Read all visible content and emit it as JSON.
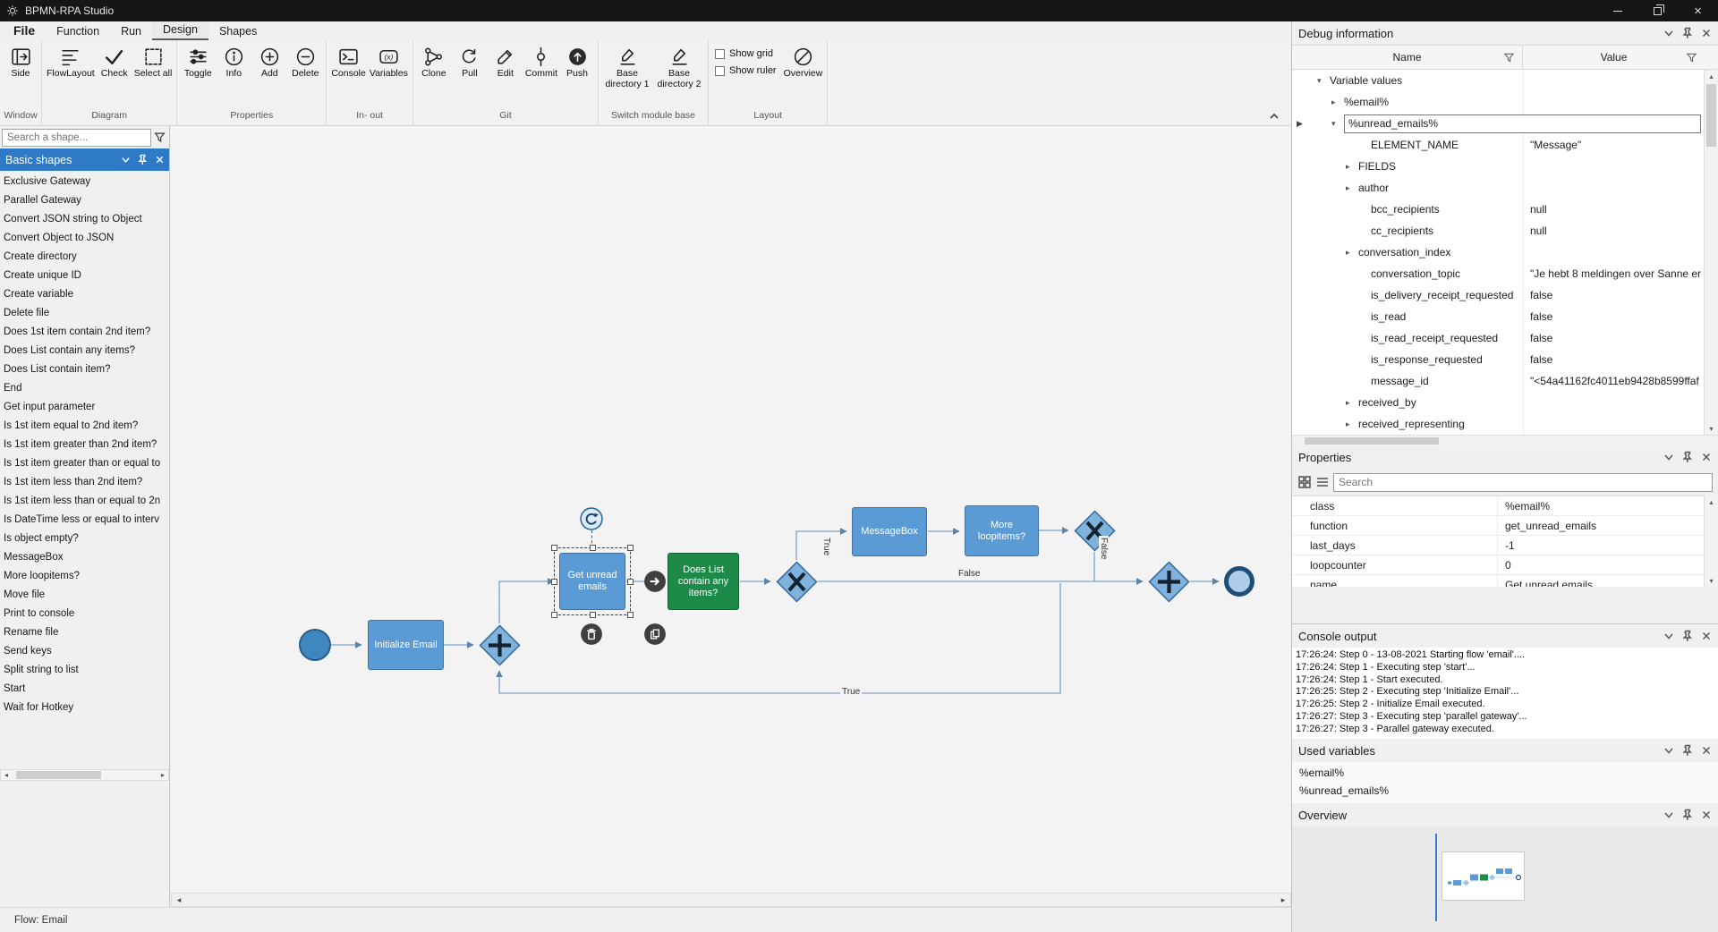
{
  "titlebar": {
    "title": "BPMN-RPA Studio"
  },
  "menu": {
    "items": [
      "File",
      "Function",
      "Run",
      "Design",
      "Shapes"
    ],
    "active": "Design"
  },
  "ribbon": {
    "buttons": {
      "side": "Side",
      "flowlayout": "FlowLayout",
      "check": "Check",
      "select_all": "Select all",
      "toggle": "Toggle",
      "info": "Info",
      "add": "Add",
      "delete": "Delete",
      "console": "Console",
      "variables": "Variables",
      "clone": "Clone",
      "pull": "Pull",
      "edit": "Edit",
      "commit": "Commit",
      "push": "Push",
      "base_dir_1": "Base directory 1",
      "base_dir_2": "Base directory 2",
      "overview": "Overview"
    },
    "checkboxes": {
      "show_grid": "Show grid",
      "show_ruler": "Show ruler"
    },
    "group_labels": {
      "window": "Window",
      "diagram": "Diagram",
      "properties": "Properties",
      "in_out": "In- out",
      "git": "Git",
      "switch_module_base": "Switch module base",
      "layout": "Layout"
    }
  },
  "sidebar": {
    "search_placeholder": "Search a shape...",
    "header": "Basic shapes",
    "items": [
      "Exclusive Gateway",
      "Parallel Gateway",
      "Convert JSON string to Object",
      "Convert Object to JSON",
      "Create directory",
      "Create unique ID",
      "Create variable",
      "Delete file",
      "Does 1st item contain 2nd item?",
      "Does List contain any items?",
      "Does List contain item?",
      "End",
      "Get input parameter",
      "Is 1st item equal to 2nd item?",
      "Is 1st item greater than 2nd item?",
      "Is 1st item greater than or equal to",
      "Is 1st item less than 2nd item?",
      "Is 1st item less than or equal to 2n",
      "Is DateTime less or equal to interv",
      "Is object empty?",
      "MessageBox",
      "More loopitems?",
      "Move file",
      "Print to console",
      "Rename file",
      "Send keys",
      "Split string to list",
      "Start",
      "Wait for Hotkey"
    ]
  },
  "canvas": {
    "nodes": {
      "initialize_email": "Initialize Email",
      "get_unread_emails": "Get unread emails",
      "does_list": "Does List contain any items?",
      "messagebox": "MessageBox",
      "more_loopitems": "More loopitems?"
    },
    "edge_labels": {
      "true_up": "True",
      "false_mid": "False",
      "false_down": "False",
      "true_bottom": "True"
    }
  },
  "debug": {
    "title": "Debug information",
    "columns": {
      "name": "Name",
      "value": "Value"
    },
    "rows": [
      {
        "exp": "▾",
        "name": "Variable values",
        "value": ""
      },
      {
        "exp": "▸",
        "name": "%email%",
        "value": ""
      },
      {
        "exp": "▾",
        "name": "%unread_emails%",
        "value": "",
        "selected": true
      },
      {
        "exp": "",
        "name": "ELEMENT_NAME",
        "value": "\"Message\""
      },
      {
        "exp": "▸",
        "name": "FIELDS",
        "value": ""
      },
      {
        "exp": "▸",
        "name": "author",
        "value": ""
      },
      {
        "exp": "",
        "name": "bcc_recipients",
        "value": "null"
      },
      {
        "exp": "",
        "name": "cc_recipients",
        "value": "null"
      },
      {
        "exp": "▸",
        "name": "conversation_index",
        "value": ""
      },
      {
        "exp": "",
        "name": "conversation_topic",
        "value": "\"Je hebt 8 meldingen over Sanne er"
      },
      {
        "exp": "",
        "name": "is_delivery_receipt_requested",
        "value": "false"
      },
      {
        "exp": "",
        "name": "is_read",
        "value": "false"
      },
      {
        "exp": "",
        "name": "is_read_receipt_requested",
        "value": "false"
      },
      {
        "exp": "",
        "name": "is_response_requested",
        "value": "false"
      },
      {
        "exp": "",
        "name": "message_id",
        "value": "\"<54a41162fc4011eb9428b8599ffaf"
      },
      {
        "exp": "▸",
        "name": "received_by",
        "value": ""
      },
      {
        "exp": "▸",
        "name": "received_representing",
        "value": ""
      }
    ]
  },
  "properties": {
    "title": "Properties",
    "search_placeholder": "Search",
    "rows": [
      {
        "name": "class",
        "value": "%email%"
      },
      {
        "name": "function",
        "value": "get_unread_emails"
      },
      {
        "name": "last_days",
        "value": "-1"
      },
      {
        "name": "loopcounter",
        "value": "0"
      },
      {
        "name": "name",
        "value": "Get unread emails"
      }
    ]
  },
  "console": {
    "title": "Console output",
    "lines": [
      "17:26:24: Step 0 - 13-08-2021 Starting flow 'email'....",
      "17:26:24: Step 1 - Executing step 'start'...",
      "17:26:24: Step 1 - Start executed.",
      "17:26:25: Step 2 - Executing step 'Initialize Email'...",
      "17:26:25: Step 2 - Initialize Email executed.",
      "17:26:27: Step 3 - Executing step 'parallel gateway'...",
      "17:26:27: Step 3 - Parallel gateway executed."
    ]
  },
  "used_variables": {
    "title": "Used variables",
    "items": [
      "%email%",
      "%unread_emails%"
    ]
  },
  "overview_panel": {
    "title": "Overview"
  },
  "statusbar": {
    "text": "Flow: Email"
  },
  "colors": {
    "titlebar": "#161616",
    "task_fill": "#5b9bd5",
    "task_border": "#41719c",
    "gateway_fill": "#7fb2dd",
    "green_task": "#1e8a4a",
    "sidebar_header": "#2e7ac7",
    "connector": "#7aa3c8",
    "selection": "#3c3c3c",
    "overview_viewport": "#3a7bd5"
  },
  "icons": [
    "gear-icon",
    "minimize-icon",
    "maximize-icon",
    "close-icon",
    "funnel-icon",
    "pin-icon",
    "chevron-down-icon",
    "loop-icon",
    "trash-icon",
    "copy-icon",
    "arrow-right-icon"
  ]
}
